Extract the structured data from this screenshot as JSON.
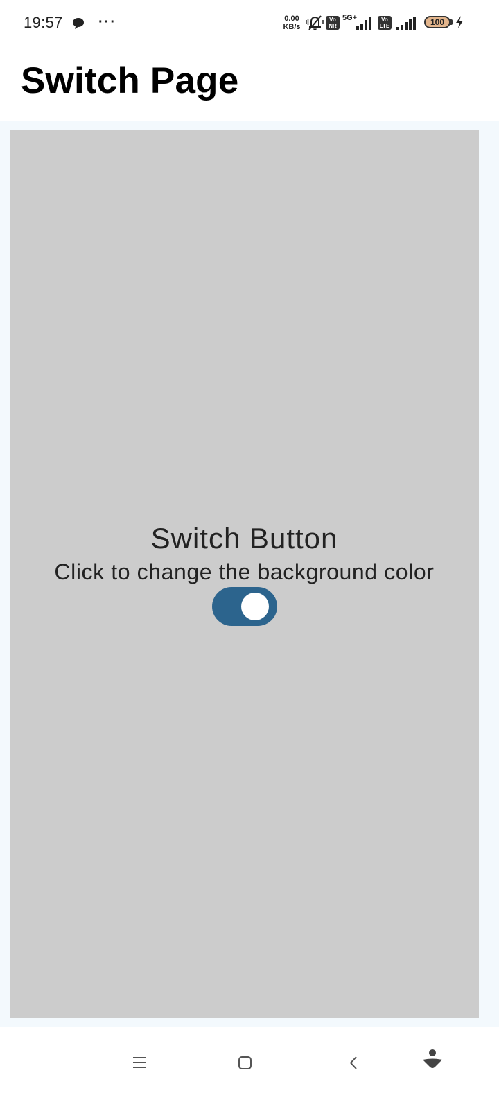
{
  "status_bar": {
    "time": "19:57",
    "more": "···",
    "net_speed_value": "0.00",
    "net_speed_unit": "KB/s",
    "badge1_top": "Vo",
    "badge1_bottom": "NR",
    "net_type": "5G+",
    "badge2_top": "Vo",
    "badge2_bottom": "LTE",
    "battery": "100"
  },
  "page": {
    "title": "Switch Page"
  },
  "panel": {
    "title": "Switch Button",
    "subtitle": "Click to change the background color",
    "switch_on": true,
    "background_color": "#cccccc",
    "switch_color": "#2c648d"
  },
  "colors": {
    "content_frame": "#f3f9fd",
    "panel": "#cccccc",
    "switch_track": "#2c648d",
    "switch_knob": "#ffffff"
  },
  "nav_bar": {
    "icons": [
      "menu-icon",
      "home-icon",
      "back-icon",
      "assistant-icon"
    ]
  }
}
